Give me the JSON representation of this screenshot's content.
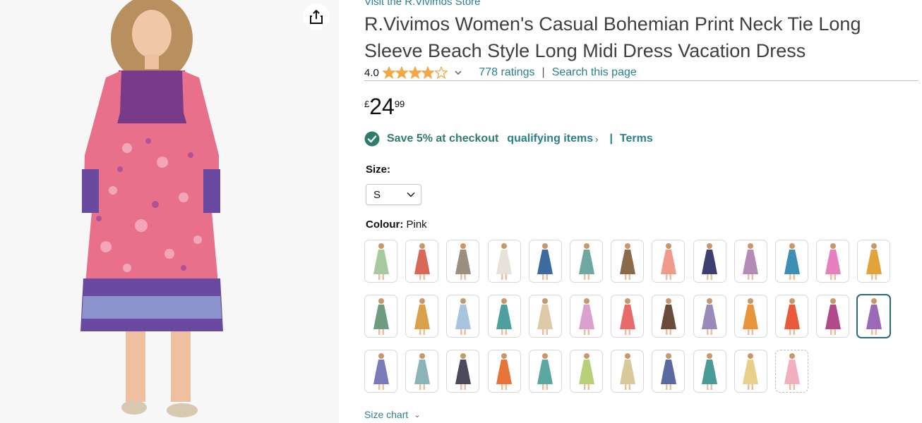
{
  "store": {
    "link_text": "Visit the R.Vivimos Store"
  },
  "product": {
    "title": "R.Vivimos Women's Casual Bohemian Print Neck Tie Long Sleeve Beach Style Long Midi Dress Vacation Dress",
    "rating_value": "4.0",
    "rating_fraction": 0.8,
    "ratings_count": "778 ratings",
    "search_link": "Search this page"
  },
  "price": {
    "symbol": "£",
    "whole": "24",
    "fraction": "99"
  },
  "promotion": {
    "save_text": "Save 5% at checkout",
    "qualifying_link": "qualifying items",
    "separator": "|",
    "terms_link": "Terms",
    "accent": "#2f7b6e"
  },
  "size": {
    "label": "Size:",
    "selected": "S"
  },
  "colour": {
    "label": "Colour:",
    "selected_name": "Pink",
    "swatches": [
      {
        "id": 1,
        "color": "#a8c9a0"
      },
      {
        "id": 2,
        "color": "#d9685a"
      },
      {
        "id": 3,
        "color": "#9b8f7e"
      },
      {
        "id": 4,
        "color": "#e7e2d8"
      },
      {
        "id": 5,
        "color": "#3c6c9e"
      },
      {
        "id": 6,
        "color": "#6fa8a0"
      },
      {
        "id": 7,
        "color": "#8a6a4a"
      },
      {
        "id": 8,
        "color": "#ef9a8a"
      },
      {
        "id": 9,
        "color": "#3e3e70"
      },
      {
        "id": 10,
        "color": "#b48bb8"
      },
      {
        "id": 11,
        "color": "#3d8fb4"
      },
      {
        "id": 12,
        "color": "#e680c0"
      },
      {
        "id": 13,
        "color": "#e3a23a"
      },
      {
        "id": 14,
        "color": "#6f9c7e"
      },
      {
        "id": 15,
        "color": "#d9a24a"
      },
      {
        "id": 16,
        "color": "#a8c4de"
      },
      {
        "id": 17,
        "color": "#4ea0a0"
      },
      {
        "id": 18,
        "color": "#e0c9a8"
      },
      {
        "id": 19,
        "color": "#d9a0d0"
      },
      {
        "id": 20,
        "color": "#e86a6a"
      },
      {
        "id": 21,
        "color": "#6a4a3a"
      },
      {
        "id": 22,
        "color": "#9a8ab8"
      },
      {
        "id": 23,
        "color": "#e8943a"
      },
      {
        "id": 24,
        "color": "#e85a3a"
      },
      {
        "id": 25,
        "color": "#b04a8a"
      },
      {
        "id": 26,
        "color": "#9a6ab8"
      },
      {
        "id": 27,
        "color": "#7a7ab8"
      },
      {
        "id": 28,
        "color": "#8ab4b8"
      },
      {
        "id": 29,
        "color": "#4a4a5a"
      },
      {
        "id": 30,
        "color": "#e8743a"
      },
      {
        "id": 31,
        "color": "#5aa8a0"
      },
      {
        "id": 32,
        "color": "#b8d07a"
      },
      {
        "id": 33,
        "color": "#d9c89a"
      },
      {
        "id": 34,
        "color": "#5a6aa0"
      },
      {
        "id": 35,
        "color": "#4a9a98"
      },
      {
        "id": 36,
        "color": "#e8d08a"
      },
      {
        "id": 37,
        "color": "#f0b0c0"
      }
    ],
    "selected_index": 25
  },
  "size_chart": {
    "label": "Size chart"
  },
  "colors": {
    "link": "#2a7f8a",
    "star": "#f3a847",
    "title": "#3f3f3f"
  }
}
